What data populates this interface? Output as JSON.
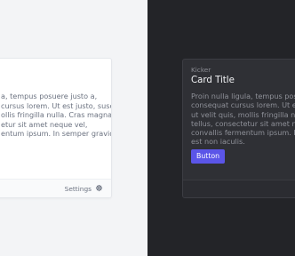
{
  "light_card": {
    "body_lines": [
      "a, tempus posuere justo a,",
      "cursus lorem. Ut est justo, suscipit",
      "ollis fringilla nulla. Cras magna",
      "etur sit amet neque vel,",
      "entum ipsum. In semper gravida"
    ],
    "settings_label": "Settings"
  },
  "dark_card": {
    "kicker": "Kicker",
    "title": "Card Title",
    "body_lines": [
      "Proin nulla ligula, tempus posuere",
      "consequat cursus lorem. Ut est",
      "ut velit quis, mollis fringilla nulla",
      "tellus, consectetur sit amet neque",
      "convallis fermentum ipsum. In se",
      "est non iaculis."
    ],
    "button_label": "Button"
  },
  "colors": {
    "light_bg": "#f3f4f6",
    "dark_bg": "#232428",
    "accent": "#5b55e8"
  }
}
